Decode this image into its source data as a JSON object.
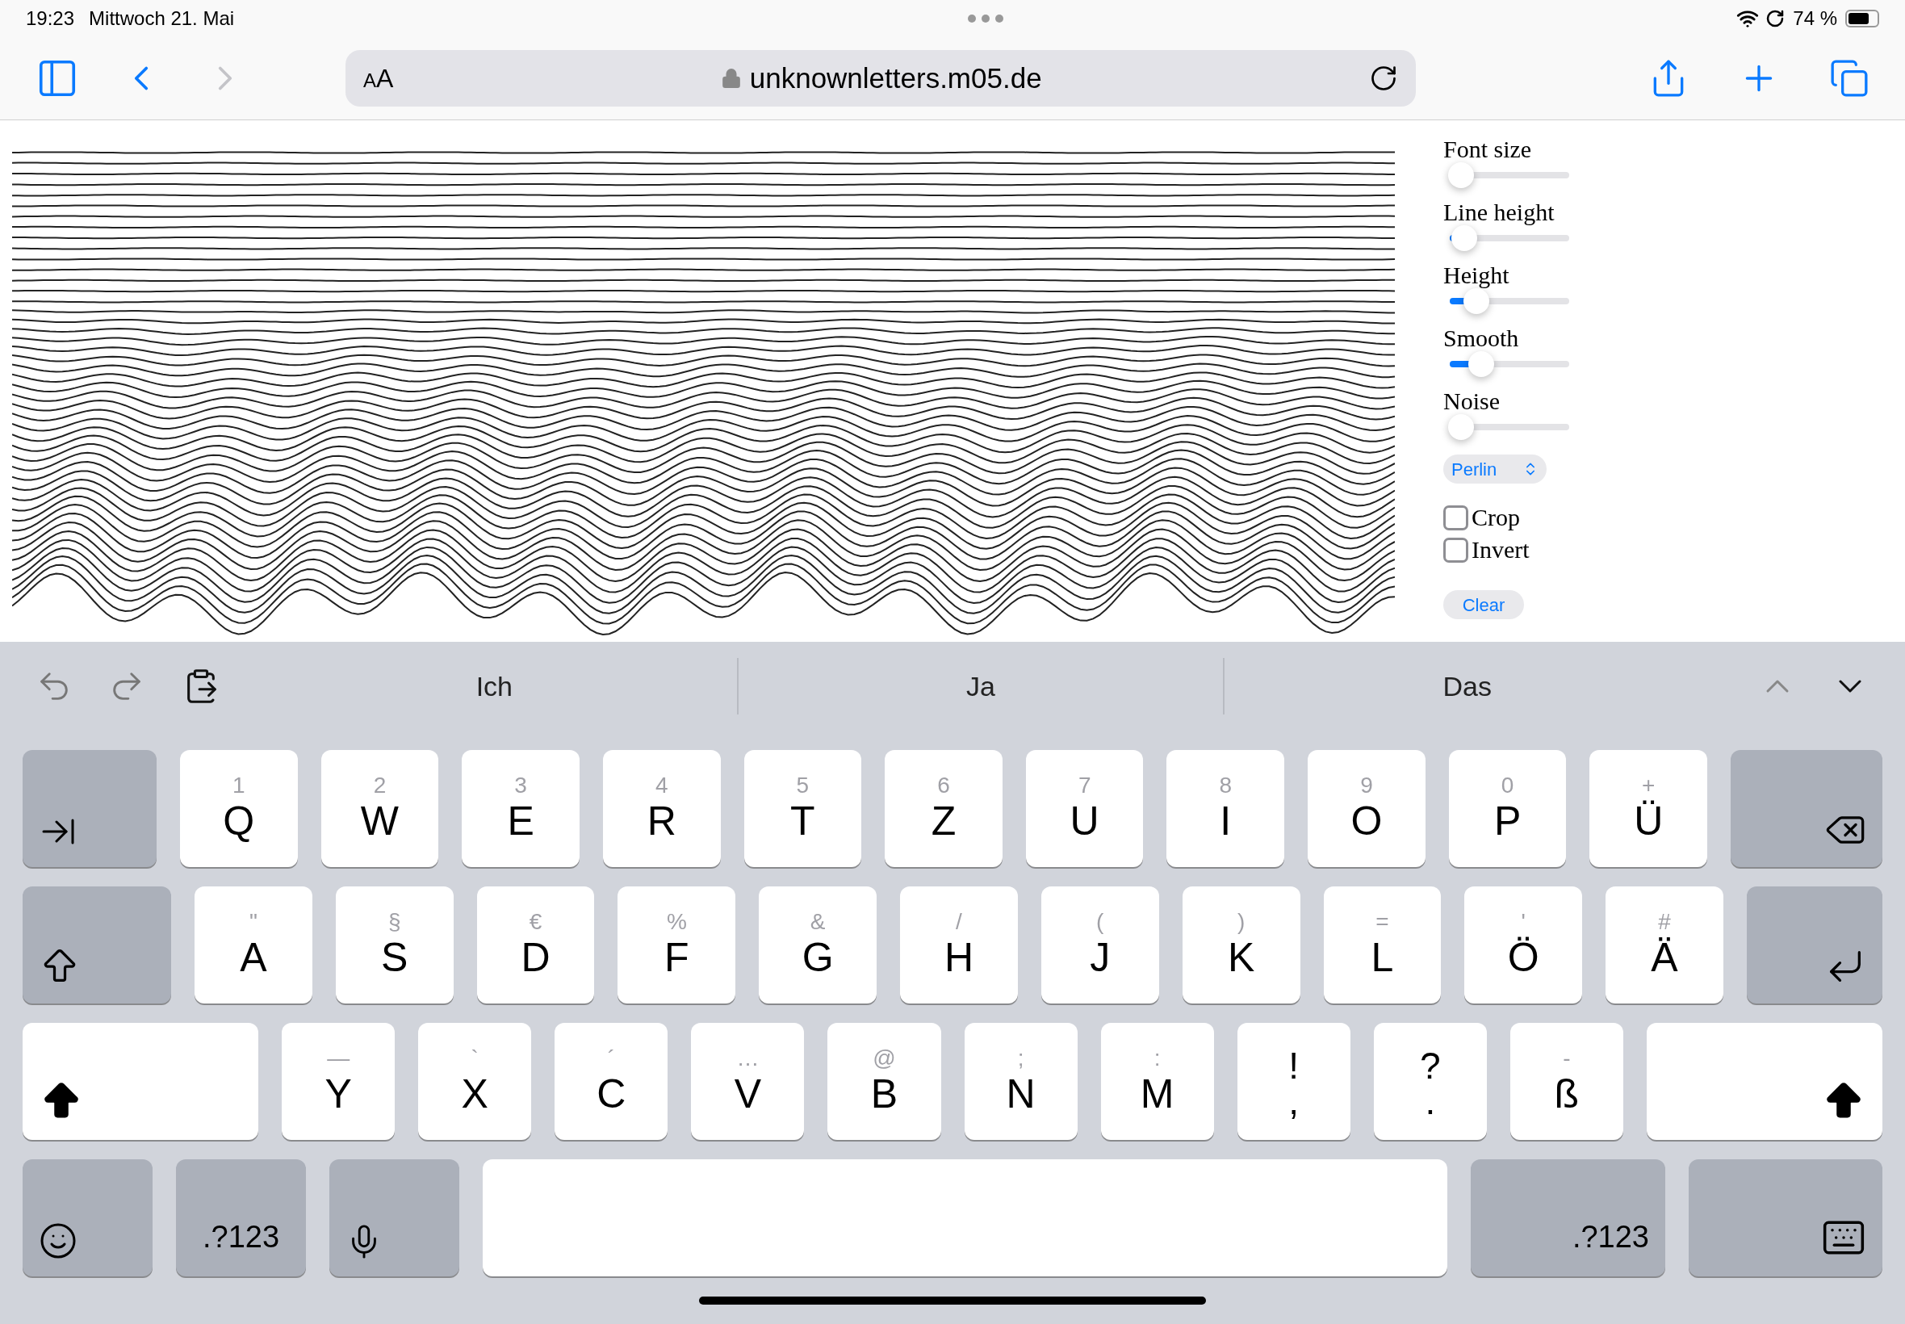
{
  "status_bar": {
    "time": "19:23",
    "date": "Mittwoch 21. Mai",
    "battery": "74 %"
  },
  "toolbar": {
    "text_size": {
      "small": "A",
      "large": "A"
    },
    "url": "unknownletters.m05.de",
    "forward": {
      "disabled": true
    }
  },
  "controls": {
    "sliders": [
      {
        "label": "Font size",
        "level": 0.04
      },
      {
        "label": "Line height",
        "level": 0.07
      },
      {
        "label": "Height",
        "level": 0.17
      },
      {
        "label": "Smooth",
        "level": 0.21
      },
      {
        "label": "Noise",
        "level": 0.04
      }
    ],
    "select": {
      "value": "Perlin"
    },
    "checkboxes": [
      {
        "label": "Crop",
        "checked": false
      },
      {
        "label": "Invert",
        "checked": false
      }
    ],
    "button": "Clear"
  },
  "keyboard": {
    "suggestions": [
      "Ich",
      "Ja",
      "Das"
    ],
    "shift_on": true,
    "rows": [
      [
        {
          "kind": "tab"
        },
        {
          "kind": "letter",
          "label": "Q",
          "hint": "1"
        },
        {
          "kind": "letter",
          "label": "W",
          "hint": "2"
        },
        {
          "kind": "letter",
          "label": "E",
          "hint": "3"
        },
        {
          "kind": "letter",
          "label": "R",
          "hint": "4"
        },
        {
          "kind": "letter",
          "label": "T",
          "hint": "5"
        },
        {
          "kind": "letter",
          "label": "Z",
          "hint": "6"
        },
        {
          "kind": "letter",
          "label": "U",
          "hint": "7"
        },
        {
          "kind": "letter",
          "label": "I",
          "hint": "8"
        },
        {
          "kind": "letter",
          "label": "O",
          "hint": "9"
        },
        {
          "kind": "letter",
          "label": "P",
          "hint": "0"
        },
        {
          "kind": "letter",
          "label": "Ü",
          "hint": "+"
        },
        {
          "kind": "delete"
        }
      ],
      [
        {
          "kind": "capslock"
        },
        {
          "kind": "letter",
          "label": "A",
          "hint": "\""
        },
        {
          "kind": "letter",
          "label": "S",
          "hint": "§"
        },
        {
          "kind": "letter",
          "label": "D",
          "hint": "€"
        },
        {
          "kind": "letter",
          "label": "F",
          "hint": "%"
        },
        {
          "kind": "letter",
          "label": "G",
          "hint": "&"
        },
        {
          "kind": "letter",
          "label": "H",
          "hint": "/"
        },
        {
          "kind": "letter",
          "label": "J",
          "hint": "("
        },
        {
          "kind": "letter",
          "label": "K",
          "hint": ")"
        },
        {
          "kind": "letter",
          "label": "L",
          "hint": "="
        },
        {
          "kind": "letter",
          "label": "Ö",
          "hint": "'"
        },
        {
          "kind": "letter",
          "label": "Ä",
          "hint": "#"
        },
        {
          "kind": "return"
        }
      ],
      [
        {
          "kind": "shift"
        },
        {
          "kind": "letter",
          "label": "Y",
          "hint": "—"
        },
        {
          "kind": "letter",
          "label": "X",
          "hint": "`"
        },
        {
          "kind": "letter",
          "label": "C",
          "hint": "´"
        },
        {
          "kind": "letter",
          "label": "V",
          "hint": "…"
        },
        {
          "kind": "letter",
          "label": "B",
          "hint": "@"
        },
        {
          "kind": "letter",
          "label": "N",
          "hint": ";"
        },
        {
          "kind": "letter",
          "label": "M",
          "hint": ":"
        },
        {
          "kind": "punct",
          "label": ",",
          "hint": "!"
        },
        {
          "kind": "punct",
          "label": ".",
          "hint": "?"
        },
        {
          "kind": "letter",
          "label": "ß",
          "hint": "-"
        },
        {
          "kind": "shift"
        }
      ],
      [
        {
          "kind": "emoji"
        },
        {
          "kind": "numbers",
          "label": ".?123"
        },
        {
          "kind": "mic"
        },
        {
          "kind": "space"
        },
        {
          "kind": "numbers_wide",
          "label": ".?123"
        },
        {
          "kind": "hide"
        }
      ]
    ]
  }
}
